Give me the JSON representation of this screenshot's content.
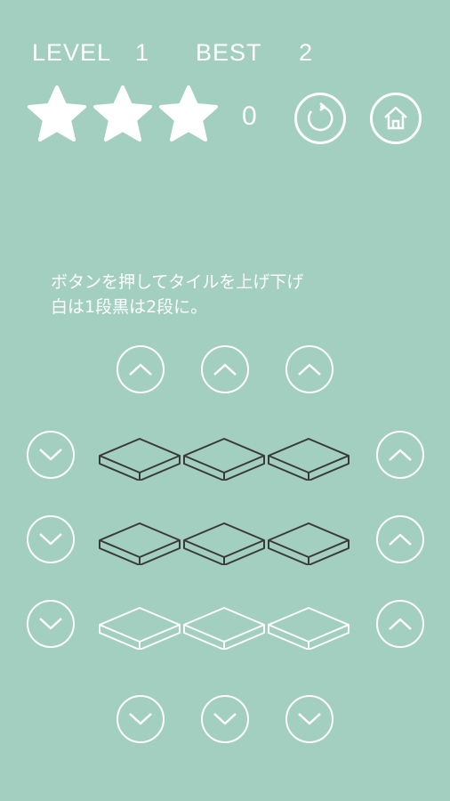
{
  "header": {
    "level_label": "LEVEL",
    "level_value": "1",
    "best_label": "BEST",
    "best_value": "2",
    "stars_filled": 3,
    "stars_total": 3,
    "score": "0"
  },
  "controls": {
    "restart_icon": "restart-icon",
    "home_icon": "home-icon"
  },
  "instructions": "ボタンを押してタイルを上げ下げ\n白は1段黒は2段に。",
  "grid": {
    "rows": [
      [
        "dark",
        "dark",
        "dark"
      ],
      [
        "dark",
        "dark",
        "dark"
      ],
      [
        "white",
        "white",
        "white"
      ]
    ]
  },
  "colors": {
    "background": "#a3cfc0",
    "tile_dark": "#3a3a3a",
    "tile_white": "#ffffff",
    "ui": "#ffffff"
  }
}
